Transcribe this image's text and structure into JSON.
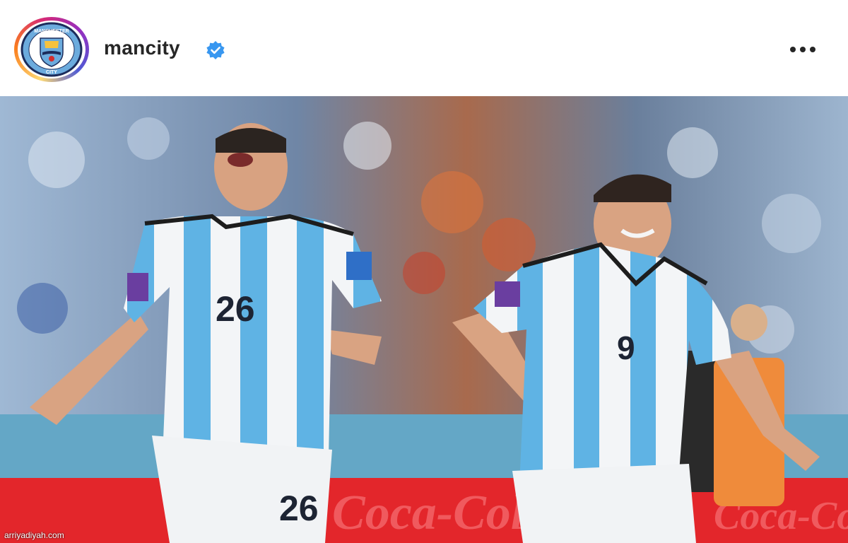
{
  "post": {
    "username": "mancity",
    "verified": true,
    "avatar_badge": {
      "top_text": "MANCHESTER",
      "bottom_text": "CITY"
    },
    "more_icon": "more-horizontal-icon"
  },
  "photo": {
    "player_left_number": "26",
    "player_left_shorts_number": "26",
    "player_right_number": "9",
    "ad_board_text": "Coca-Cola"
  },
  "watermark": "arriyadiyah.com",
  "colors": {
    "argentina_blue": "#5fb3e4",
    "ad_red": "#e3262b",
    "verified_blue": "#3897f0",
    "avatar_ring_start": "#feda75",
    "avatar_ring_end": "#962fbf"
  }
}
